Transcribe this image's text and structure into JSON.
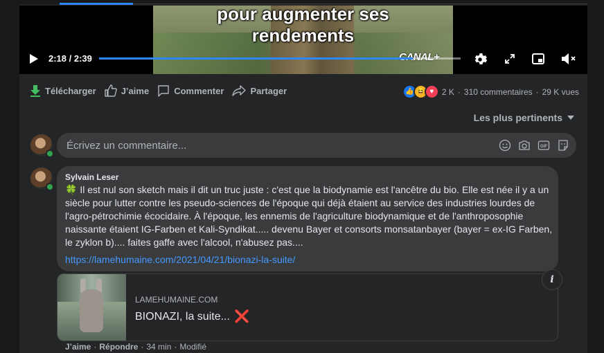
{
  "video": {
    "subtitle_line1": "pour augmenter ses",
    "subtitle_line2": "rendements",
    "watermark": "CANAL+",
    "current_time": "2:18",
    "duration": "2:39",
    "time_display": "2:18 / 2:39",
    "progress_fraction": 0.868
  },
  "actions": {
    "download": "Télécharger",
    "like": "J’aime",
    "comment": "Commenter",
    "share": "Partager"
  },
  "stats": {
    "reactions_count": "2 K",
    "comments": "310 commentaires",
    "views": "29 K vues",
    "separator": "·"
  },
  "sort": {
    "label": "Les plus pertinents"
  },
  "composer": {
    "placeholder": "Écrivez un commentaire..."
  },
  "comment": {
    "author": "Sylvain Leser",
    "text": "🍀 Il est nul son sketch mais il dit un truc juste : c'est que la biodynamie est l'ancêtre du bio. Elle est née il y a un siècle pour lutter contre les pseudo-sciences de l'époque qui déjà étaient au service des industries lourdes de l'agro-pétrochimie écocidaire. À l'époque, les ennemis de l'agriculture biodynamique et de l'anthroposophie naissante étaient IG-Farben et Kali-Syndikat..... devenu Bayer et consorts monsatanbayer (bayer = ex-IG Farben, le zyklon b).... faites gaffe avec l'alcool, n'abusez pas....",
    "link": "https://lamehumaine.com/2021/04/21/bionazi-la-suite/",
    "preview": {
      "site": "LAMEHUMAINE.COM",
      "title": "BIONAZI, la suite...",
      "title_emoji": "❌"
    },
    "meta": {
      "like": "J’aime",
      "dot1": "·",
      "reply": "Répondre",
      "dot2": "·",
      "time": "34 min",
      "dot3": "·",
      "edited": "Modifié"
    }
  },
  "colors": {
    "accent": "#2d88ff",
    "bubble": "#3a3b3c",
    "link": "#4599ff",
    "online": "#31a24c",
    "download_icon": "#45bd62"
  }
}
